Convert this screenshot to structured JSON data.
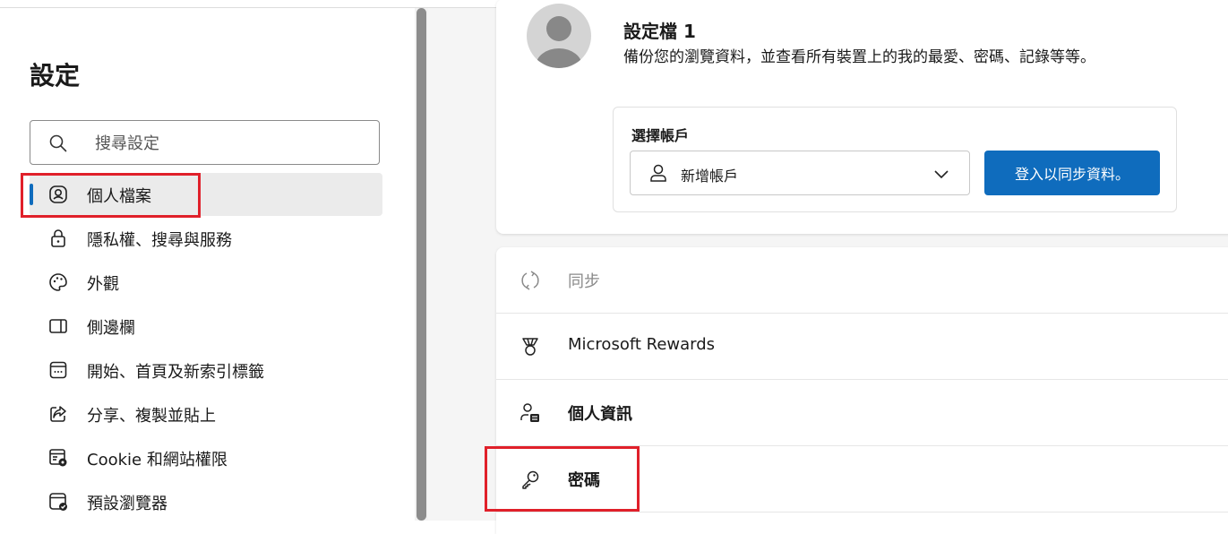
{
  "sidebar": {
    "title": "設定",
    "search": {
      "placeholder": "搜尋設定",
      "icon": "search-icon"
    },
    "items": [
      {
        "label": "個人檔案",
        "icon": "profile-icon",
        "active": true
      },
      {
        "label": "隱私權、搜尋與服務",
        "icon": "lock-icon"
      },
      {
        "label": "外觀",
        "icon": "palette-icon"
      },
      {
        "label": "側邊欄",
        "icon": "sidebar-icon"
      },
      {
        "label": "開始、首頁及新索引標籤",
        "icon": "home-tab-icon"
      },
      {
        "label": "分享、複製並貼上",
        "icon": "share-icon"
      },
      {
        "label": "Cookie 和網站權限",
        "icon": "cookie-settings-icon"
      },
      {
        "label": "預設瀏覽器",
        "icon": "default-browser-icon"
      }
    ]
  },
  "profile": {
    "name": "設定檔 1",
    "description": "備份您的瀏覽資料，並查看所有裝置上的我的最愛、密碼、記錄等等。",
    "account": {
      "label": "選擇帳戶",
      "selected": "新增帳戶",
      "signin_button": "登入以同步資料。"
    }
  },
  "settings_rows": [
    {
      "label": "同步",
      "icon": "sync-icon",
      "disabled": true
    },
    {
      "label": "Microsoft Rewards",
      "icon": "rewards-icon"
    },
    {
      "label": "個人資訊",
      "icon": "personal-info-icon"
    },
    {
      "label": "密碼",
      "icon": "key-icon"
    }
  ],
  "colors": {
    "accent": "#0f6cbd",
    "highlight": "#e0202a",
    "main_bg": "#f5f5f5"
  }
}
